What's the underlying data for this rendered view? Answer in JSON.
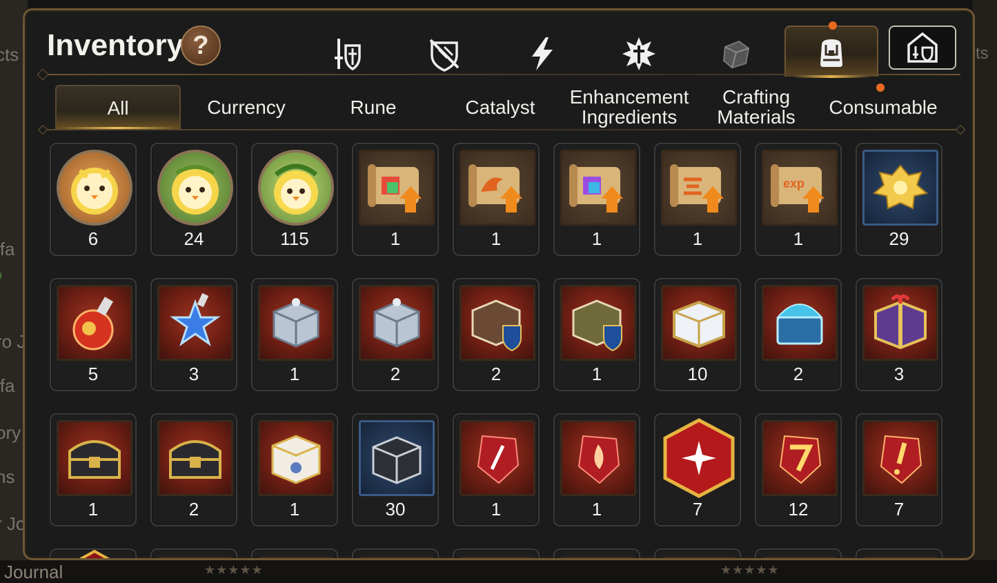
{
  "background": {
    "left_fragments": [
      "cts",
      "ifa",
      "9",
      "ro J",
      "ifa",
      "ory",
      "ns",
      "r Jo"
    ],
    "right_fragment": "ts",
    "bottom_label": "Journal"
  },
  "header": {
    "title": "Inventory",
    "help_label": "?"
  },
  "top_tabs": [
    {
      "icon": "sword-shield-icon",
      "active": false
    },
    {
      "icon": "broken-shield-icon",
      "active": false
    },
    {
      "icon": "lightning-icon",
      "active": false
    },
    {
      "icon": "burst-cross-icon",
      "active": false
    },
    {
      "icon": "cube-icon",
      "active": false
    },
    {
      "icon": "backpack-icon",
      "active": true,
      "notification": true
    },
    {
      "icon": "storage-building-icon",
      "active": false
    }
  ],
  "category_tabs": [
    {
      "label": "All",
      "active": true
    },
    {
      "label": "Currency"
    },
    {
      "label": "Rune"
    },
    {
      "label": "Catalyst"
    },
    {
      "label": "Enhancement\nIngredients"
    },
    {
      "label": "Crafting\nMaterials"
    },
    {
      "label": "Consumable",
      "notification": true
    }
  ],
  "items": [
    {
      "icon": "golden-chick-portrait-icon",
      "count": "6"
    },
    {
      "icon": "chick-laurel-portrait-icon",
      "count": "24"
    },
    {
      "icon": "chick-laurel-green-portrait-icon",
      "count": "115"
    },
    {
      "icon": "scroll-rainbow-upgrade-icon",
      "count": "1"
    },
    {
      "icon": "scroll-dragon-upgrade-icon",
      "count": "1"
    },
    {
      "icon": "scroll-rainbow-upgrade-icon",
      "count": "1"
    },
    {
      "icon": "scroll-glyph-upgrade-icon",
      "count": "1"
    },
    {
      "icon": "scroll-exp-upgrade-icon",
      "count": "1"
    },
    {
      "icon": "gold-crystal-cluster-icon",
      "count": "29"
    },
    {
      "icon": "red-potion-icon",
      "count": "5"
    },
    {
      "icon": "blue-star-potion-icon",
      "count": "3"
    },
    {
      "icon": "silver-box-icon",
      "count": "1"
    },
    {
      "icon": "silver-box-icon",
      "count": "2"
    },
    {
      "icon": "ornate-chest-blue-badge-icon",
      "count": "2"
    },
    {
      "icon": "green-chest-blue-badge-icon",
      "count": "1"
    },
    {
      "icon": "white-gold-chest-icon",
      "count": "10"
    },
    {
      "icon": "crystal-dome-chest-icon",
      "count": "2"
    },
    {
      "icon": "purple-gift-chest-icon",
      "count": "3"
    },
    {
      "icon": "dark-gold-chest-icon",
      "count": "1"
    },
    {
      "icon": "dark-gold-chest-icon",
      "count": "2"
    },
    {
      "icon": "white-ornate-box-icon",
      "count": "1"
    },
    {
      "icon": "black-silver-box-icon",
      "count": "30"
    },
    {
      "icon": "red-gem-sword-icon",
      "count": "1"
    },
    {
      "icon": "red-gem-flame-icon",
      "count": "1"
    },
    {
      "icon": "red-gem-star-hex-icon",
      "count": "7"
    },
    {
      "icon": "red-gem-seven-icon",
      "count": "12"
    },
    {
      "icon": "red-gem-exclaim-icon",
      "count": "7"
    }
  ],
  "colors": {
    "panel_bg": "#1b1b1b",
    "border_gold": "#6d5734",
    "accent_gold": "#f0c45c",
    "notification": "#e76a1f",
    "text": "#f0eee9"
  }
}
